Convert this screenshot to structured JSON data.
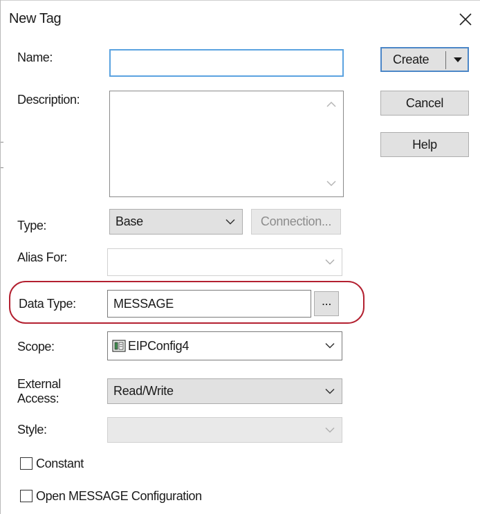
{
  "dialog": {
    "title": "New Tag",
    "close_icon": "close-icon"
  },
  "fields": {
    "name_label": "Name:",
    "name_value": "",
    "description_label": "Description:",
    "description_value": "",
    "type_label": "Type:",
    "type_value": "Base",
    "connection_button": "Connection...",
    "alias_label": "Alias For:",
    "alias_value": "",
    "datatype_label": "Data Type:",
    "datatype_value": "MESSAGE",
    "browse_button": "...",
    "scope_label": "Scope:",
    "scope_value": "EIPConfig4",
    "scope_icon": "controller-icon",
    "external_access_label_line1": "External",
    "external_access_label_line2": "Access:",
    "external_access_value": "Read/Write",
    "style_label": "Style:",
    "style_value": ""
  },
  "checkboxes": {
    "constant_label": "Constant",
    "constant_checked": false,
    "open_config_label": "Open MESSAGE Configuration",
    "open_config_checked": false
  },
  "buttons": {
    "create": "Create",
    "cancel": "Cancel",
    "help": "Help"
  },
  "colors": {
    "focus_border": "#5aa2e0",
    "highlight_ring": "#b32030",
    "default_button_border": "#4b86c7"
  }
}
